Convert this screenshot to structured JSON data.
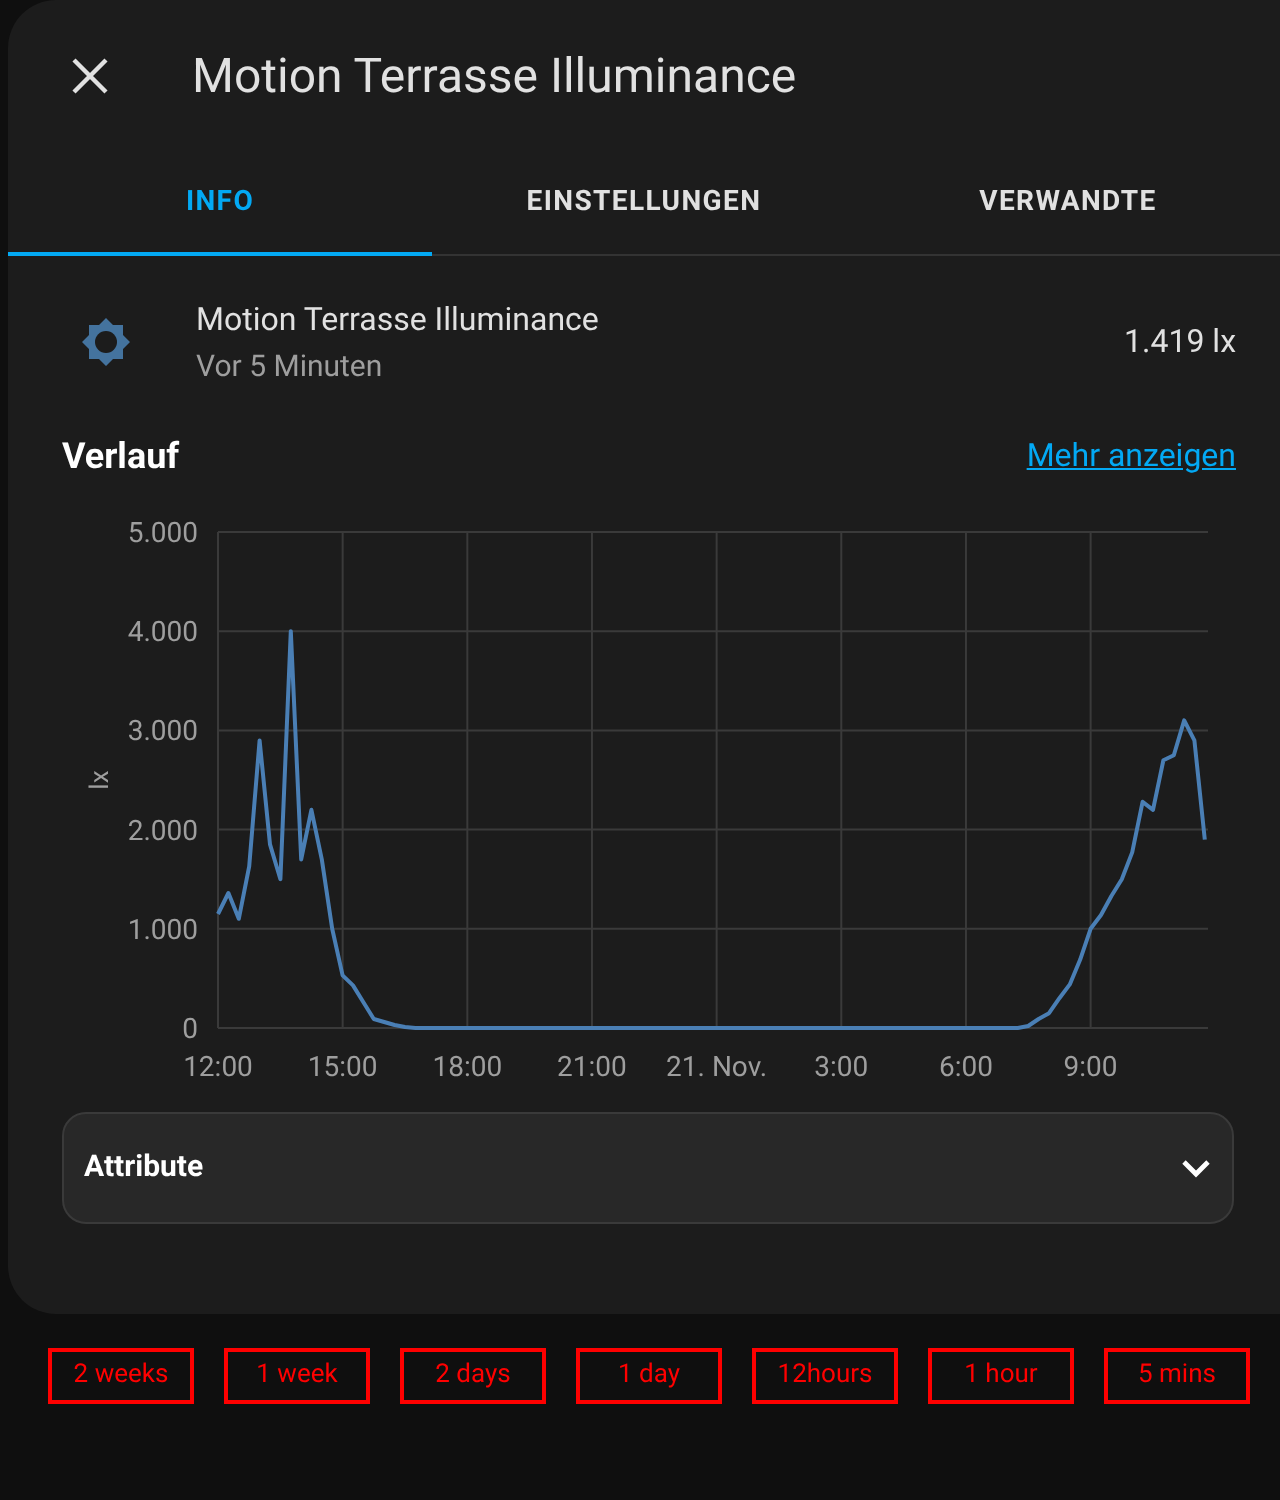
{
  "dialog": {
    "title": "Motion Terrasse Illuminance"
  },
  "tabs": [
    {
      "label": "INFO",
      "selected": true
    },
    {
      "label": "EINSTELLUNGEN",
      "selected": false
    },
    {
      "label": "VERWANDTE",
      "selected": false
    }
  ],
  "entity": {
    "name": "Motion Terrasse Illuminance",
    "last_changed": "Vor 5 Minuten",
    "state": "1.419 lx"
  },
  "history": {
    "title": "Verlauf",
    "link": "Mehr anzeigen",
    "chart_data": {
      "type": "line",
      "ylabel": "lx",
      "ylim": [
        0,
        5000
      ],
      "grid": true,
      "yticks": [
        {
          "value": 0,
          "label": "0"
        },
        {
          "value": 1000,
          "label": "1.000"
        },
        {
          "value": 2000,
          "label": "2.000"
        },
        {
          "value": 3000,
          "label": "3.000"
        },
        {
          "value": 4000,
          "label": "4.000"
        },
        {
          "value": 5000,
          "label": "5.000"
        }
      ],
      "categories": [
        "12:00",
        null,
        null,
        null,
        null,
        null,
        null,
        null,
        null,
        null,
        null,
        null,
        "15:00",
        null,
        null,
        null,
        null,
        null,
        null,
        null,
        null,
        null,
        null,
        null,
        "18:00",
        null,
        null,
        null,
        null,
        null,
        null,
        null,
        null,
        null,
        null,
        null,
        "21:00",
        null,
        null,
        null,
        null,
        null,
        null,
        null,
        null,
        null,
        null,
        null,
        "21. Nov.",
        null,
        null,
        null,
        null,
        null,
        null,
        null,
        null,
        null,
        null,
        null,
        "3:00",
        null,
        null,
        null,
        null,
        null,
        null,
        null,
        null,
        null,
        null,
        null,
        "6:00",
        null,
        null,
        null,
        null,
        null,
        null,
        null,
        null,
        null,
        null,
        null,
        "9:00",
        null,
        null,
        null,
        null,
        null,
        null,
        null,
        null,
        null,
        null,
        null
      ],
      "series": [
        {
          "color": "#4a7fb5",
          "values": [
            1150,
            1360,
            1100,
            1630,
            2900,
            1850,
            1500,
            4000,
            1700,
            2200,
            1700,
            1000,
            530,
            430,
            260,
            90,
            60,
            30,
            10,
            0,
            0,
            0,
            0,
            0,
            0,
            0,
            0,
            0,
            0,
            0,
            0,
            0,
            0,
            0,
            0,
            0,
            0,
            0,
            0,
            0,
            0,
            0,
            0,
            0,
            0,
            0,
            0,
            0,
            0,
            0,
            0,
            0,
            0,
            0,
            0,
            0,
            0,
            0,
            0,
            0,
            0,
            0,
            0,
            0,
            0,
            0,
            0,
            0,
            0,
            0,
            0,
            0,
            0,
            0,
            0,
            0,
            0,
            0,
            20,
            90,
            150,
            300,
            440,
            690,
            1000,
            1140,
            1330,
            1500,
            1770,
            2280,
            2200,
            2700,
            2750,
            3100,
            2900,
            1900
          ]
        }
      ]
    }
  },
  "attributes": {
    "label": "Attribute",
    "expanded": false
  },
  "range_buttons": [
    "2 weeks",
    "1 week",
    "2 days",
    "1 day",
    "12hours",
    "1 hour",
    "5 mins"
  ]
}
